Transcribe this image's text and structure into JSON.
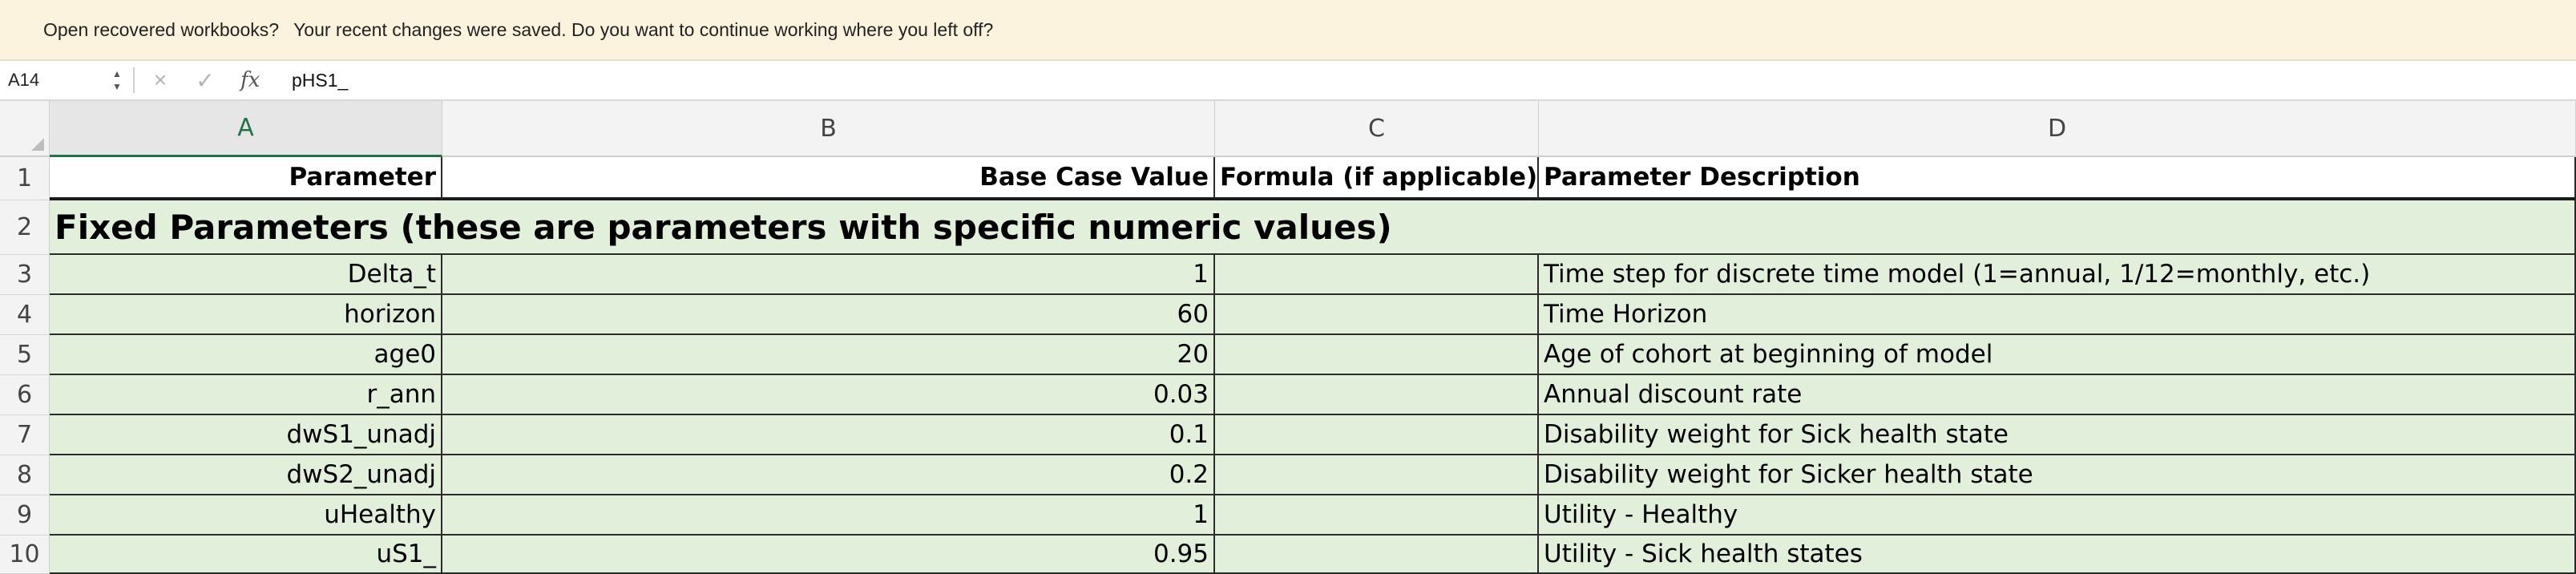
{
  "banner": {
    "title": "Open recovered workbooks?",
    "message": "Your recent changes were saved. Do you want to continue working where you left off?"
  },
  "formula_bar": {
    "name_box": "A14",
    "cancel_icon": "×",
    "enter_icon": "✓",
    "fx_label": "fx",
    "content": "pHS1_"
  },
  "columns": [
    "A",
    "B",
    "C",
    "D"
  ],
  "selected_column": "A",
  "rows": [
    {
      "num": "1",
      "A": "Parameter",
      "B": "Base Case Value",
      "C": "Formula (if applicable)",
      "D": "Parameter Description"
    },
    {
      "num": "2",
      "section": "Fixed Parameters (these are parameters with specific numeric values)"
    },
    {
      "num": "3",
      "A": "Delta_t",
      "B": "1",
      "C": "",
      "D": "Time step for discrete time model (1=annual, 1/12=monthly, etc.)"
    },
    {
      "num": "4",
      "A": "horizon",
      "B": "60",
      "C": "",
      "D": "Time Horizon"
    },
    {
      "num": "5",
      "A": "age0",
      "B": "20",
      "C": "",
      "D": "Age of cohort at beginning of model"
    },
    {
      "num": "6",
      "A": "r_ann",
      "B": "0.03",
      "C": "",
      "D": "Annual discount rate"
    },
    {
      "num": "7",
      "A": "dwS1_unadj",
      "B": "0.1",
      "C": "",
      "D": "Disability weight for Sick health state"
    },
    {
      "num": "8",
      "A": "dwS2_unadj",
      "B": "0.2",
      "C": "",
      "D": "Disability weight for Sicker health state"
    },
    {
      "num": "9",
      "A": "uHealthy",
      "B": "1",
      "C": "",
      "D": "Utility - Healthy"
    },
    {
      "num": "10",
      "A": "uS1_",
      "B": "0.95",
      "C": "",
      "D": "Utility - Sick health states"
    }
  ],
  "colors": {
    "banner_bg": "#fbf3dd",
    "fill_green": "#e2efda",
    "selected_header": "#217346"
  }
}
